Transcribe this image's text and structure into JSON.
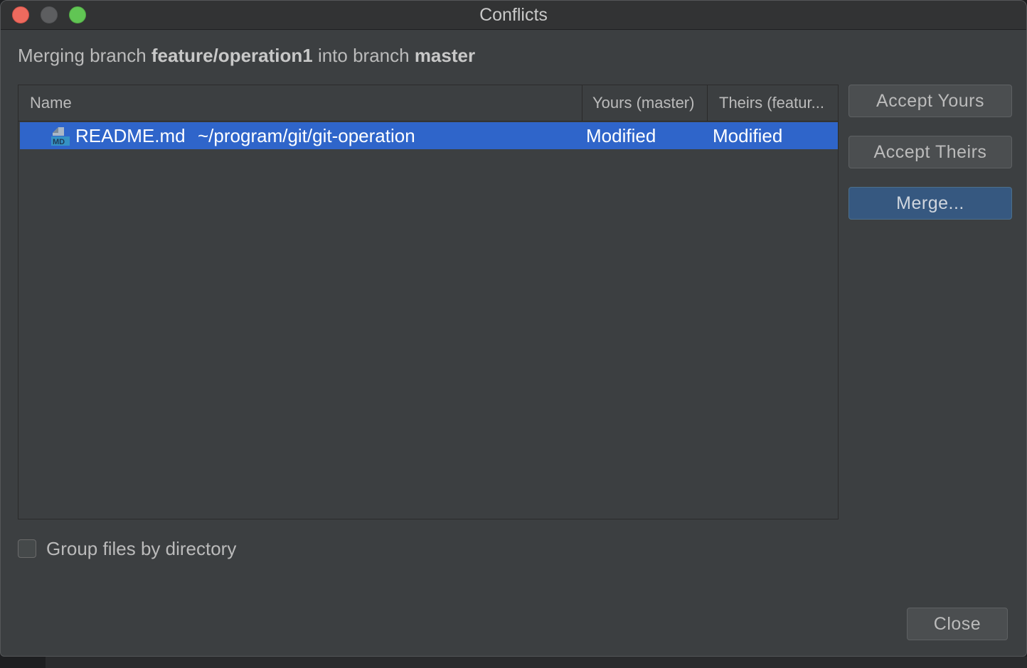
{
  "window": {
    "title": "Conflicts"
  },
  "merge_info": {
    "prefix": "Merging branch ",
    "source_branch": "feature/operation1",
    "middle": " into branch ",
    "target_branch": "master"
  },
  "table": {
    "columns": [
      "Name",
      "Yours (master)",
      "Theirs (featur..."
    ],
    "rows": [
      {
        "icon": "markdown-file-icon",
        "icon_badge": "MD",
        "name": "README.md",
        "path": "~/program/git/git-operation",
        "yours": "Modified",
        "theirs": "Modified",
        "selected": true
      }
    ]
  },
  "actions": {
    "accept_yours": "Accept Yours",
    "accept_theirs": "Accept Theirs",
    "merge": "Merge..."
  },
  "options": {
    "group_by_directory_label": "Group files by directory",
    "group_by_directory_checked": false
  },
  "footer": {
    "close": "Close"
  },
  "colors": {
    "selection": "#2f65ca",
    "default_button_bg": "#365880",
    "dialog_bg": "#3c3f41"
  }
}
